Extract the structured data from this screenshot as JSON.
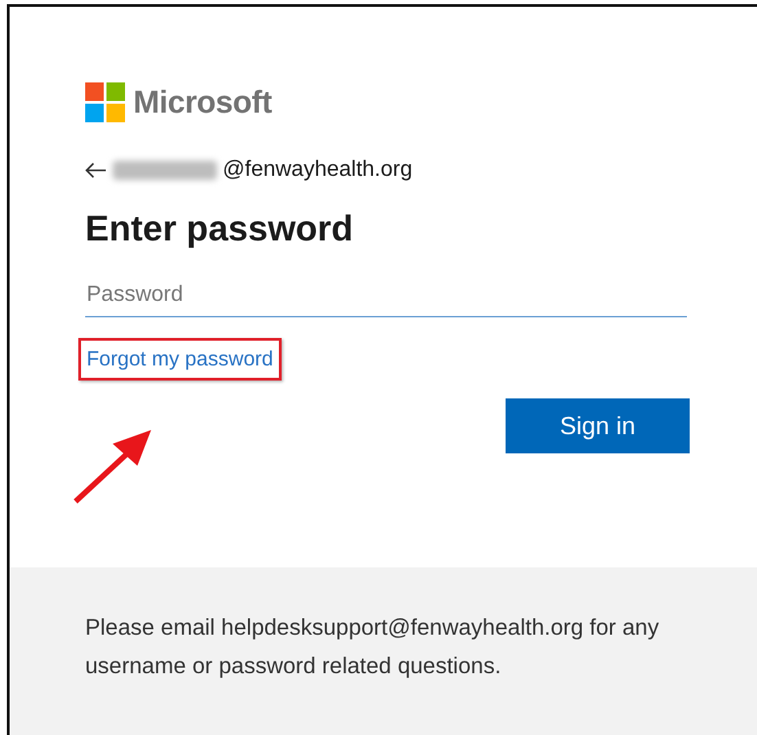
{
  "logo": {
    "text": "Microsoft"
  },
  "account": {
    "redacted": true,
    "text": "@fenwayhealth.org"
  },
  "title": "Enter password",
  "password": {
    "placeholder": "Password"
  },
  "forgot_link": {
    "text": "Forgot my password",
    "highlighted": true
  },
  "annotation_arrow": true,
  "buttons": [
    {
      "label": "Sign in",
      "kind": "primary"
    }
  ],
  "footer": {
    "text": "Please email helpdesksupport@fenwayhealth.org for any username or password related questions."
  }
}
